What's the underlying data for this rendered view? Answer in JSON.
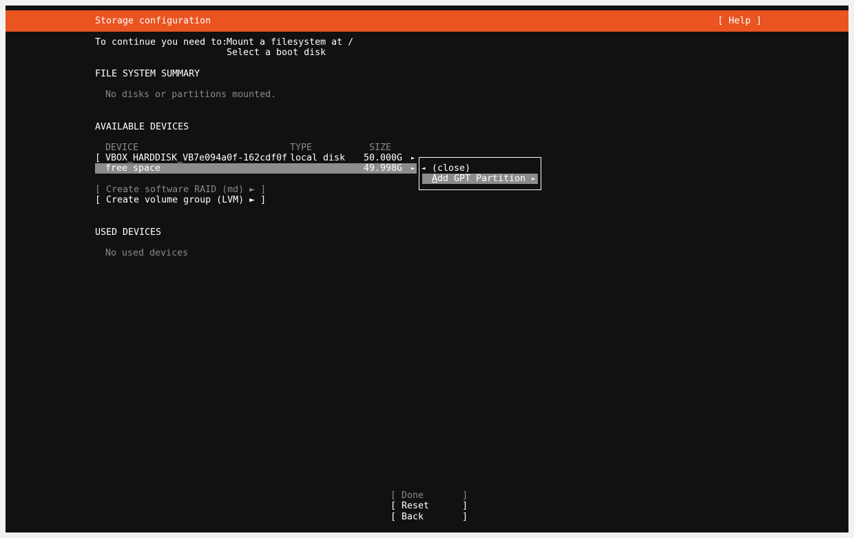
{
  "header": {
    "title": "Storage configuration",
    "help_button": "[ Help ]"
  },
  "intro": {
    "prefix": "To continue you need to:",
    "tasks": [
      "Mount a filesystem at /",
      "Select a boot disk"
    ]
  },
  "fs_summary": {
    "heading": "FILE SYSTEM SUMMARY",
    "empty_text": "No disks or partitions mounted."
  },
  "available": {
    "heading": "AVAILABLE DEVICES",
    "columns": [
      "DEVICE",
      "TYPE",
      "SIZE"
    ],
    "disk": {
      "bracket": "[",
      "name": "VBOX_HARDDISK_VB7e094a0f-162cdf0f",
      "type": "local disk",
      "size": "50.000G",
      "arrow": "►"
    },
    "free_space": {
      "name": "free space",
      "size": "49.998G",
      "arrow": "►"
    },
    "create_raid": "[ Create software RAID (md) ► ]",
    "create_lvm": "[ Create volume group (LVM) ► ]"
  },
  "popup_menu": {
    "close_arrow": "◄",
    "close_label": "(close)",
    "add_gpt_first_letter": "A",
    "add_gpt_rest": "dd GPT Partition",
    "add_gpt_arrow": "►"
  },
  "used": {
    "heading": "USED DEVICES",
    "empty_text": "No used devices"
  },
  "footer": {
    "done": "[ Done       ]",
    "reset": "[ Reset      ]",
    "back": "[ Back       ]"
  },
  "colors": {
    "accent": "#e95420",
    "background": "#111111",
    "highlight": "#8c8c8c",
    "dim_text": "#8a8a8a"
  }
}
